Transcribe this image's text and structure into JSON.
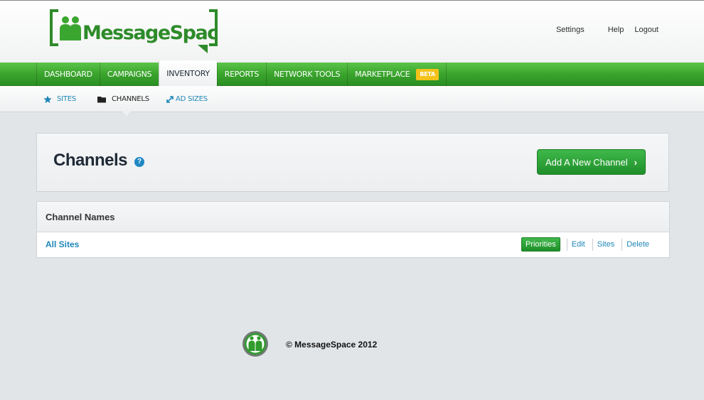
{
  "header": {
    "logo_text": "MessageSpace",
    "links": {
      "settings": "Settings",
      "help": "Help",
      "logout": "Logout"
    }
  },
  "nav": {
    "items": [
      {
        "label": "DASHBOARD"
      },
      {
        "label": "CAMPAIGNS"
      },
      {
        "label": "INVENTORY",
        "active": true
      },
      {
        "label": "REPORTS"
      },
      {
        "label": "NETWORK TOOLS"
      },
      {
        "label": "MARKETPLACE",
        "badge": "BETA"
      }
    ]
  },
  "subnav": {
    "items": [
      {
        "label": "SITES",
        "icon": "star-icon"
      },
      {
        "label": "CHANNELS",
        "icon": "folder-icon",
        "active": true
      },
      {
        "label": "AD SIZES",
        "icon": "resize-icon"
      }
    ]
  },
  "page": {
    "title": "Channels",
    "help_icon_label": "?",
    "add_button_label": "Add A New Channel",
    "add_button_chevron": "›"
  },
  "table": {
    "header": "Channel Names",
    "rows": [
      {
        "name": "All Sites",
        "actions": {
          "priorities": "Priorities",
          "edit": "Edit",
          "sites": "Sites",
          "delete": "Delete"
        }
      }
    ]
  },
  "footer": {
    "copyright": "© MessageSpace 2012"
  },
  "colors": {
    "brand_green": "#2f9e2a",
    "link_blue": "#1e87b8",
    "beta_yellow": "#f4c21a",
    "help_blue": "#1f87c3"
  }
}
